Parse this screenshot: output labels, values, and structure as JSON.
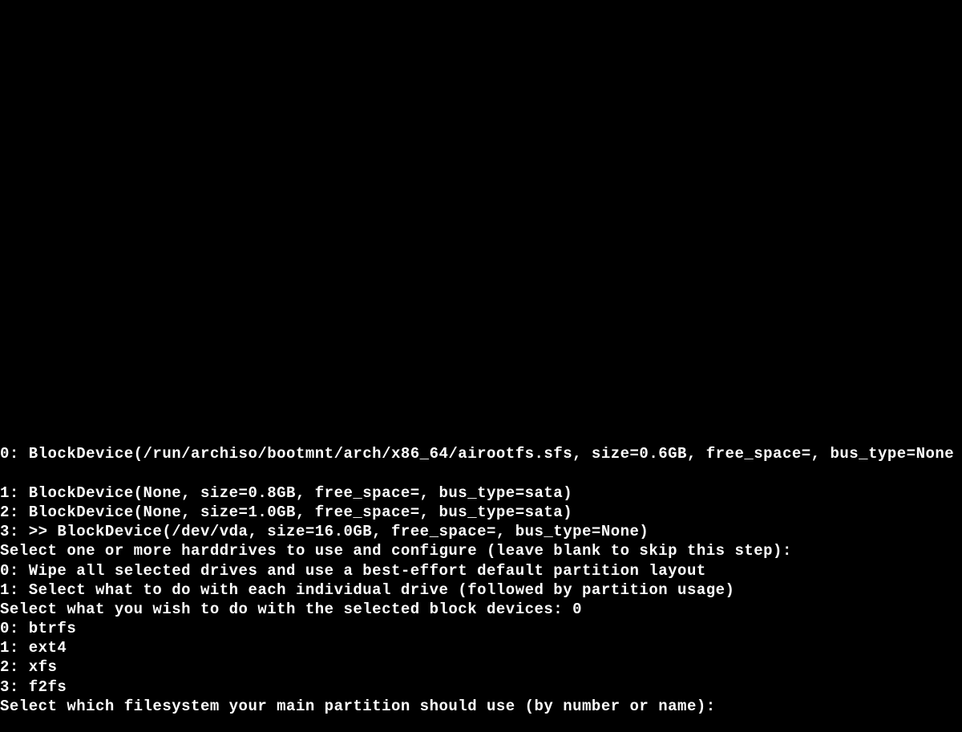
{
  "terminal": {
    "lines": [
      {
        "prefix": "0",
        "text": ": BlockDevice(/run/archiso/bootmnt/arch/x86_64/airootfs.sfs, size=0.6GB, free_space=, bus_type=None"
      },
      {
        "prefix": "",
        "text": ""
      },
      {
        "prefix": "1",
        "text": ": BlockDevice(None, size=0.8GB, free_space=, bus_type=sata)"
      },
      {
        "prefix": "2",
        "text": ": BlockDevice(None, size=1.0GB, free_space=, bus_type=sata)"
      },
      {
        "prefix": "3",
        "text": ": >> BlockDevice(/dev/vda, size=16.0GB, free_space=, bus_type=None)"
      },
      {
        "prefix": "S",
        "text": "elect one or more harddrives to use and configure (leave blank to skip this step):"
      },
      {
        "prefix": "0",
        "text": ": Wipe all selected drives and use a best-effort default partition layout"
      },
      {
        "prefix": "1",
        "text": ": Select what to do with each individual drive (followed by partition usage)"
      },
      {
        "prefix": "S",
        "text": "elect what you wish to do with the selected block devices: 0"
      },
      {
        "prefix": "0",
        "text": ": btrfs"
      },
      {
        "prefix": "1",
        "text": ": ext4"
      },
      {
        "prefix": "2",
        "text": ": xfs"
      },
      {
        "prefix": "3",
        "text": ": f2fs"
      },
      {
        "prefix": "S",
        "text": "elect which filesystem your main partition should use (by number or name):"
      }
    ]
  }
}
